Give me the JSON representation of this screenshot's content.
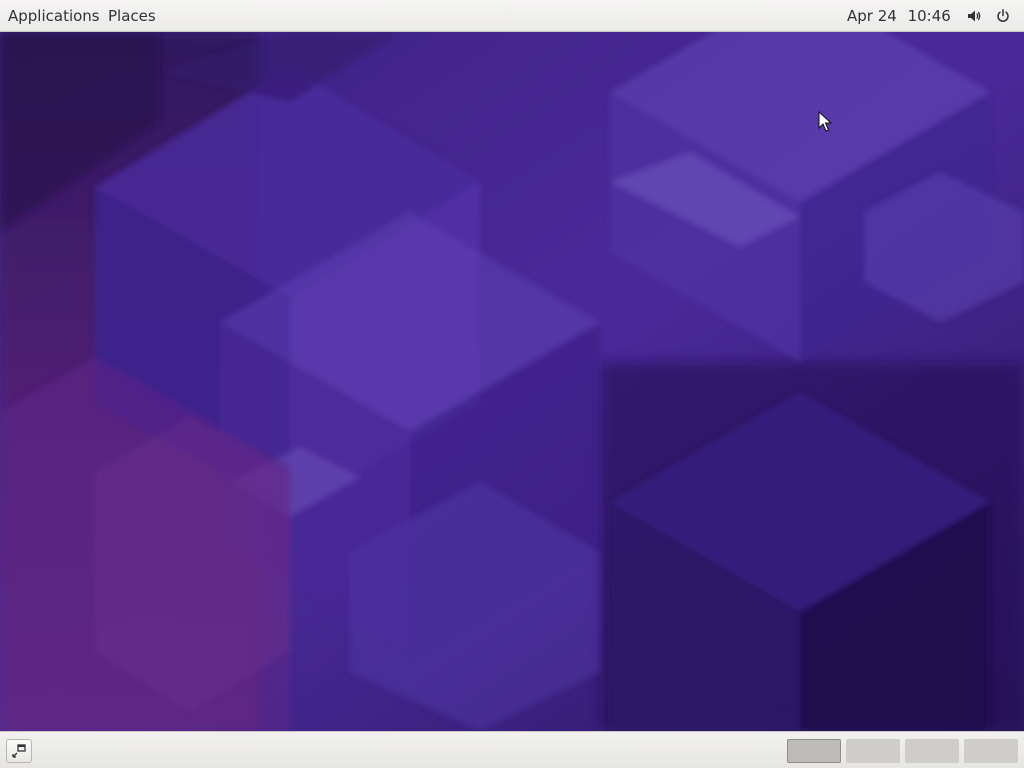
{
  "top_panel": {
    "menus": [
      {
        "label": "Applications"
      },
      {
        "label": "Places"
      }
    ],
    "clock": {
      "date": "Apr 24",
      "time": "10:46"
    },
    "tray_icons": [
      "volume-icon",
      "power-icon"
    ]
  },
  "desktop": {
    "wallpaper": "purple-hexagons",
    "colors": {
      "base": "#3f2388",
      "light": "#6a4cc0",
      "dark": "#22124f",
      "magenta": "#6b2478"
    }
  },
  "bottom_panel": {
    "show_desktop_icon": "show-desktop-icon",
    "workspaces": [
      {
        "active": true
      },
      {
        "active": false
      },
      {
        "active": false
      },
      {
        "active": false
      }
    ]
  },
  "theme": {
    "panel_bg": "#f2f1ef",
    "panel_text": "#2e3436"
  }
}
